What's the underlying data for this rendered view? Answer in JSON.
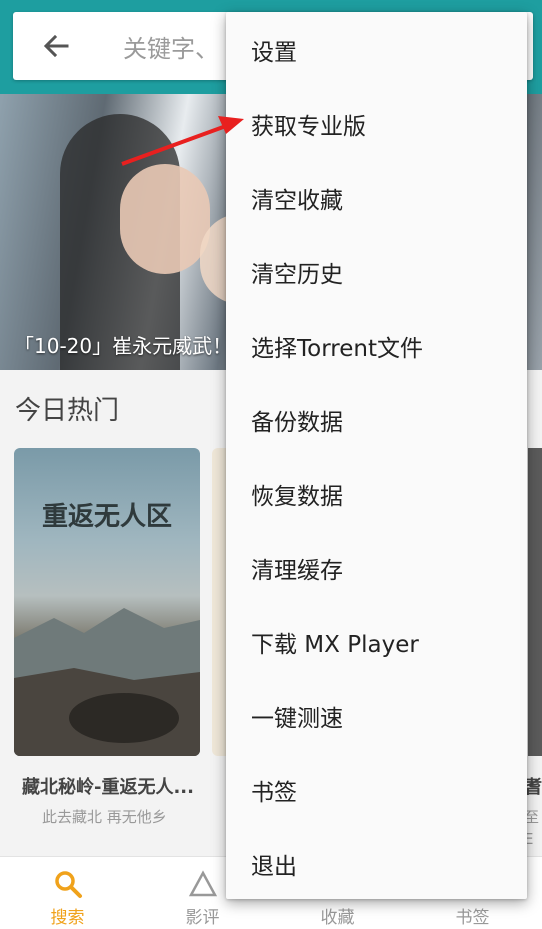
{
  "header": {
    "search_placeholder": "关键字、"
  },
  "banner": {
    "caption": "「10-20」崔永元威武！"
  },
  "section": {
    "title": "今日热门"
  },
  "poster": {
    "title_art": "重返无人区"
  },
  "movies": [
    {
      "title": "藏北秘岭-重返无人...",
      "subtitle": "此去藏北  再无他乡"
    }
  ],
  "edge_texts": [
    "耆",
    "至",
    "E"
  ],
  "bottom_nav": [
    {
      "label": "搜索",
      "icon": "search-icon",
      "active": true
    },
    {
      "label": "影评",
      "icon": "triangle-icon",
      "active": false
    },
    {
      "label": "收藏",
      "icon": "star-icon",
      "active": false
    },
    {
      "label": "书签",
      "icon": "bookmark-icon",
      "active": false
    }
  ],
  "menu": {
    "items": [
      "设置",
      "获取专业版",
      "清空收藏",
      "清空历史",
      "选择Torrent文件",
      "备份数据",
      "恢复数据",
      "清理缓存",
      "下载 MX Player",
      "一键测速",
      "书签",
      "退出"
    ]
  },
  "colors": {
    "header": "#1e9ea0",
    "active_nav": "#f0a21b",
    "annotation_arrow": "#e8201f"
  }
}
